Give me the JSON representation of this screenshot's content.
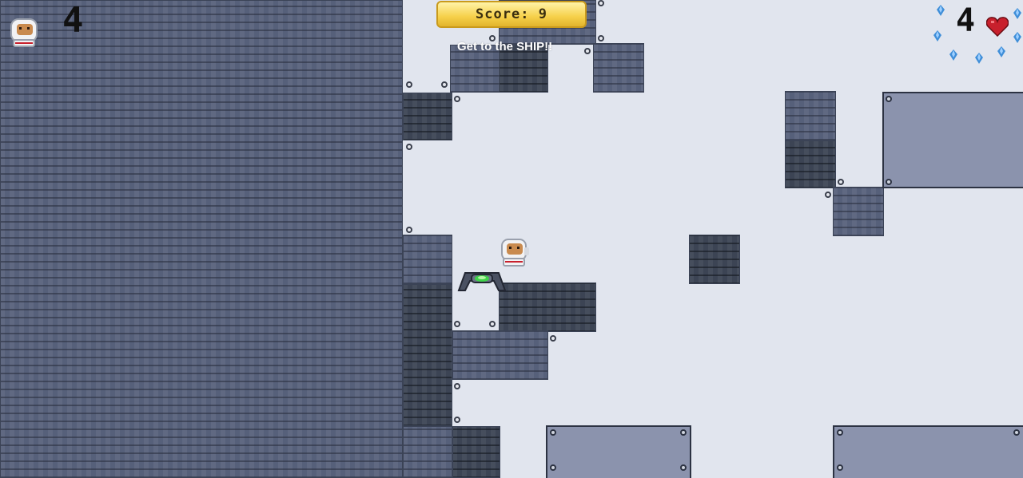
{
  "hud": {
    "lives_count": "4",
    "score_text": "Score: 9",
    "message": "Get to the SHIP!!",
    "hearts_count": "4"
  },
  "icons": {
    "lives": "astronaut-icon",
    "health": "heart-icon",
    "gems": "crystal-gem-icon"
  },
  "colors": {
    "sky": "#e1e5ee",
    "rock": "#56607a",
    "rock_dark": "#3c4454",
    "metal_plate": "#8b93ad",
    "score_gold": "#f6d04a",
    "heart_red": "#c8202c",
    "gem_blue": "#3f8ed8",
    "enemy_glow": "#3fd24a"
  }
}
